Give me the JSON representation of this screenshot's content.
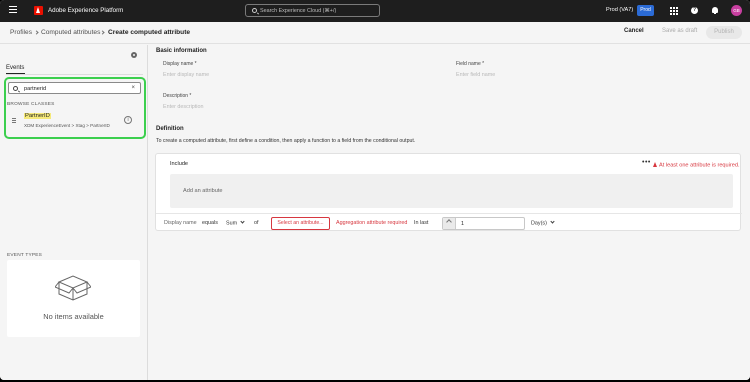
{
  "topbar": {
    "app_title": "Adobe Experience Platform",
    "search_placeholder": "Search Experience Cloud (⌘+/)",
    "org_label": "Prod (VA7)",
    "env_badge": "Prod",
    "avatar_initials": "GB",
    "brand_color": "#eb1000",
    "accent_color": "#2b6bd6"
  },
  "breadcrumb": {
    "items": [
      "Profiles",
      "Computed attributes",
      "Create computed attribute"
    ]
  },
  "actions": {
    "cancel": "Cancel",
    "save_draft": "Save as draft",
    "publish": "Publish"
  },
  "left_rail": {
    "tab": "Events",
    "search_value": "partnerid",
    "browse_classes_label": "BROWSE CLASSES",
    "class_item": {
      "name": "PartnerID",
      "path": "XDM ExperienceEvent > Xtag > PartnerID"
    },
    "event_types_label": "EVENT TYPES",
    "empty_text": "No items available"
  },
  "basic_info": {
    "heading": "Basic information",
    "display_name_label": "Display name *",
    "display_name_placeholder": "Enter display name",
    "field_name_label": "Field name *",
    "field_name_placeholder": "Enter field name",
    "description_label": "Description *",
    "description_placeholder": "Enter description"
  },
  "definition": {
    "heading": "Definition",
    "description": "To create a computed attribute, first define a condition, then apply a function to a field from the conditional output.",
    "include_label": "Include",
    "error_text": "At least one attribute is required.",
    "add_attribute": "Add an attribute",
    "row": {
      "display_name": "Display name",
      "equals": "equals",
      "function": "Sum",
      "of": "of",
      "select_attribute": "Select an attribute...",
      "aggregation_error": "Aggregation attribute required",
      "in_last": "In last",
      "lookback_value": "1",
      "unit": "Day(s)"
    },
    "error_color": "#d7373f"
  }
}
